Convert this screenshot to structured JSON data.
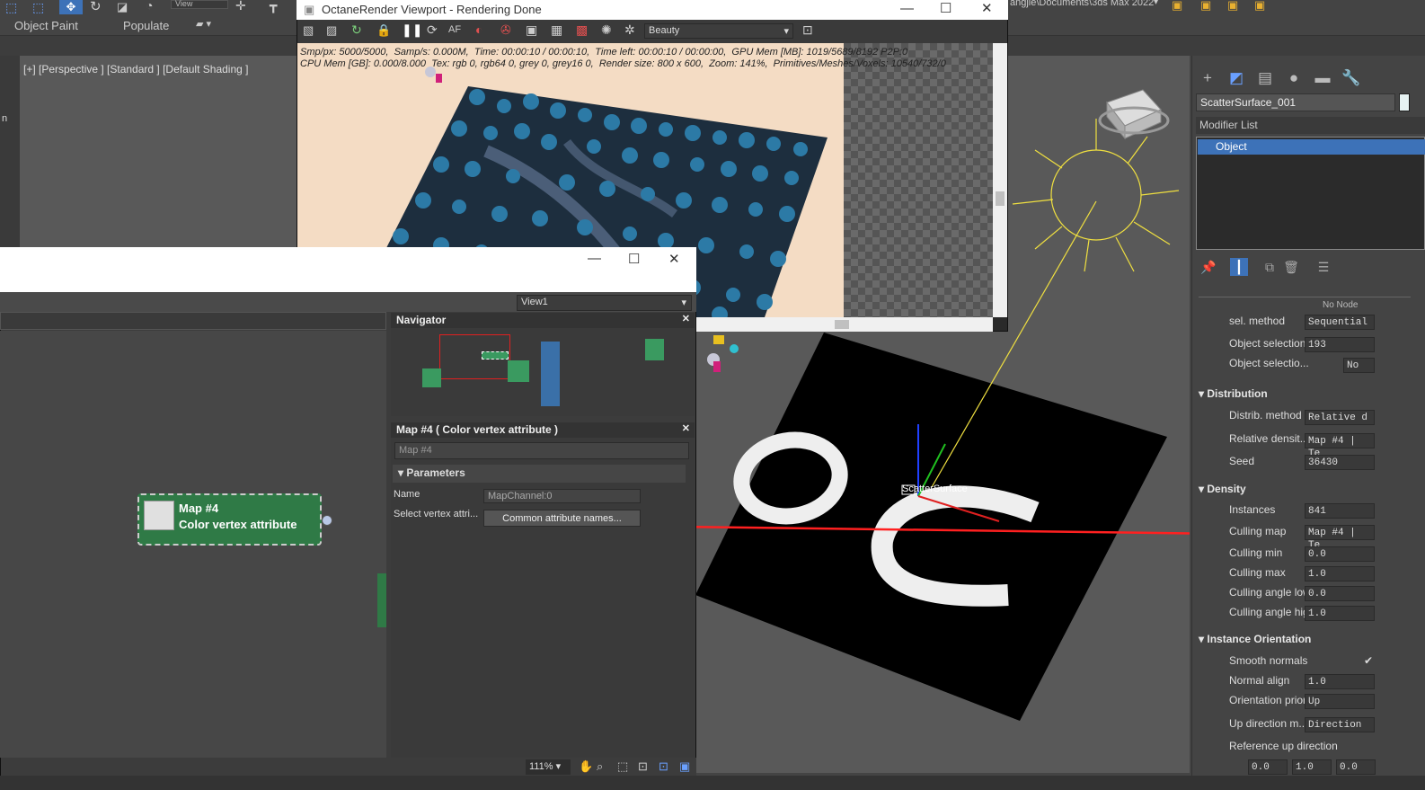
{
  "topbar": {
    "view_label": "View"
  },
  "ribbon": {
    "items": [
      "Object Paint",
      "Populate"
    ]
  },
  "path_text": "angjie\\Documents\\3ds Max 2022",
  "viewport": {
    "label": "[+] [Perspective ] [Standard ] [Default Shading ]",
    "gizmo_label": "ScatterSurface"
  },
  "octane": {
    "title": "OctaneRender Viewport - Rendering Done",
    "pass_select": "Beauty",
    "stats_line1": "Smp/px: 5000/5000,  Samp/s: 0.000M,  Time: 00:00:10 / 00:00:10,  Time left: 00:00:10 / 00:00:00,  GPU Mem [MB]: 1019/5689/8192 P2P:0",
    "stats_line2": "CPU Mem [GB]: 0.000/8.000  Tex: rgb 0, rgb64 0, grey 0, grey16 0,  Render size: 800 x 600,  Zoom: 141%,  Primitives/Meshes/Voxels: 10540/732/0"
  },
  "slate": {
    "view_select": "View1",
    "navigator_title": "Navigator",
    "node": {
      "title": "Map #4",
      "subtitle": "Color vertex attribute"
    },
    "param_editor": {
      "title": "Map #4  ( Color vertex attribute )",
      "name_field": "Map #4",
      "section": "Parameters",
      "rows": [
        {
          "label": "Name",
          "value": "MapChannel:0"
        },
        {
          "label": "Select vertex attri...",
          "value": "Common attribute names..."
        }
      ]
    },
    "zoom": "111%"
  },
  "command_panel": {
    "object_name": "ScatterSurface_001",
    "modifier_list": "Modifier List",
    "stack_item": "Object",
    "no_node": "No Node",
    "top_rows": [
      {
        "label": "sel. method",
        "value": "Sequential"
      },
      {
        "label": "Object selection...",
        "value": "193"
      },
      {
        "label": "Object selectio...",
        "value": "No"
      }
    ],
    "distribution": {
      "title": "Distribution",
      "rows": [
        {
          "label": "Distrib. method",
          "value": "Relative d"
        },
        {
          "label": "Relative densit...",
          "value": "Map #4 | Te"
        },
        {
          "label": "Seed",
          "value": "36430"
        }
      ]
    },
    "density": {
      "title": "Density",
      "rows": [
        {
          "label": "Instances",
          "value": "841"
        },
        {
          "label": "Culling map",
          "value": "Map #4 | Te"
        },
        {
          "label": "Culling min",
          "value": "0.0"
        },
        {
          "label": "Culling max",
          "value": "1.0"
        },
        {
          "label": "Culling angle low",
          "value": "0.0"
        },
        {
          "label": "Culling angle high",
          "value": "1.0"
        }
      ]
    },
    "orientation": {
      "title": "Instance Orientation",
      "rows": [
        {
          "label": "Smooth normals",
          "value": "✔"
        },
        {
          "label": "Normal align",
          "value": "1.0"
        },
        {
          "label": "Orientation prior...",
          "value": "Up"
        },
        {
          "label": "Up direction m...",
          "value": "Direction"
        },
        {
          "label": "Reference up direction",
          "value": ""
        }
      ],
      "vector": [
        "0.0",
        "1.0",
        "0.0"
      ]
    }
  }
}
